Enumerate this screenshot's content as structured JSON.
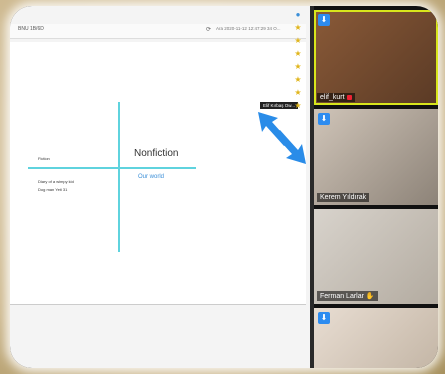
{
  "browser": {
    "url": "BNU 1B/6D",
    "tab_info": "Ara 2020-11-12 12:47:29 34 O..."
  },
  "document": {
    "column_left": "Fiction",
    "column_right": "Nonfiction",
    "right_item": "Our world",
    "left_items": [
      "Diary of a wimpy kid",
      "Dog man Yeti 31"
    ],
    "tooltip": "Elif Kırbaş Ow..."
  },
  "participants": [
    {
      "name": "elif_kurt",
      "muted": true
    },
    {
      "name": "Kerem Yıldırak"
    },
    {
      "name": "Ferman Larlar",
      "hand": "✋"
    },
    {
      "name": ""
    }
  ],
  "colors": {
    "accent_line": "#5fd3de",
    "active_speaker": "#d8e61c",
    "star": "#e0b51c",
    "arrow": "#2a8ce8"
  }
}
